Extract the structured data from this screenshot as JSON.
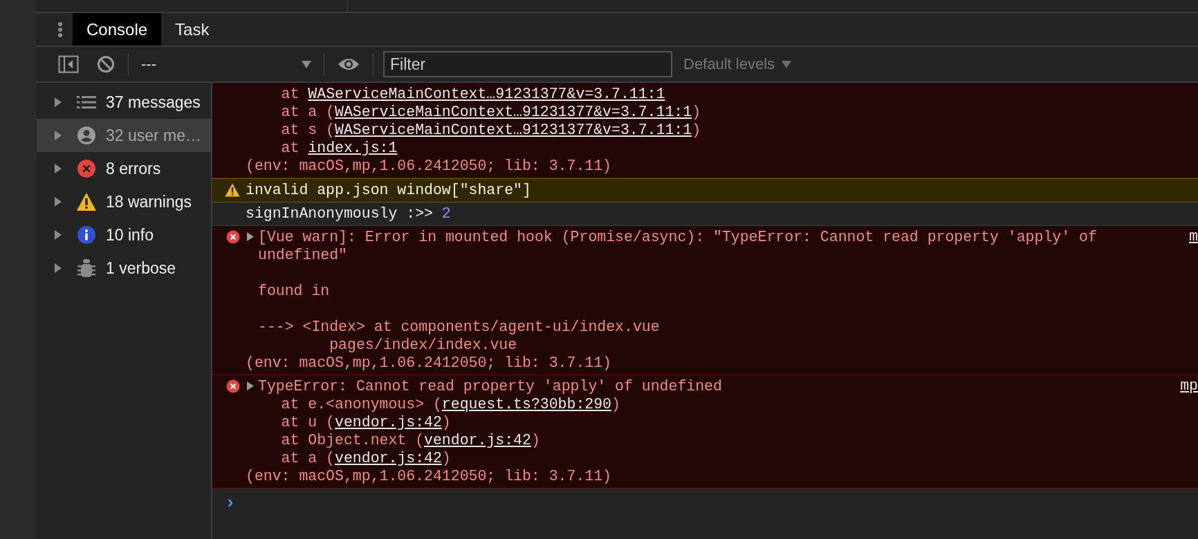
{
  "tabs": [
    {
      "label": "Console",
      "selected": true
    },
    {
      "label": "Task",
      "selected": false
    }
  ],
  "toolbar": {
    "context": "---",
    "filter": {
      "placeholder": "Filter"
    },
    "levels": "Default levels"
  },
  "sidebar": {
    "items": [
      {
        "kind": "messages",
        "label": "37 messages",
        "selected": false
      },
      {
        "kind": "user",
        "label": "32 user me…",
        "selected": true
      },
      {
        "kind": "error",
        "label": "8 errors",
        "selected": false
      },
      {
        "kind": "warning",
        "label": "18 warnings",
        "selected": false
      },
      {
        "kind": "info",
        "label": "10 info",
        "selected": false
      },
      {
        "kind": "verbose",
        "label": "1 verbose",
        "selected": false
      }
    ]
  },
  "console": {
    "messages": [
      {
        "kind": "error",
        "icon": false,
        "expandable": false,
        "lines": [
          [
            {
              "text": "    at "
            },
            {
              "text": "WAServiceMainContext…91231377&v=3.7.11:1",
              "kind": "link"
            }
          ],
          [
            {
              "text": "    at a ("
            },
            {
              "text": "WAServiceMainContext…91231377&v=3.7.11:1",
              "kind": "link"
            },
            {
              "text": ")"
            }
          ],
          [
            {
              "text": "    at s ("
            },
            {
              "text": "WAServiceMainContext…91231377&v=3.7.11:1",
              "kind": "link"
            },
            {
              "text": ")"
            }
          ],
          [
            {
              "text": "    at "
            },
            {
              "text": "index.js:1",
              "kind": "link"
            }
          ],
          [
            {
              "text": "(env: macOS,mp,1.06.2412050; lib: 3.7.11)"
            }
          ]
        ]
      },
      {
        "kind": "warning",
        "icon": true,
        "expandable": false,
        "lines": [
          [
            {
              "text": "invalid app.json window[\"share\"]"
            }
          ]
        ]
      },
      {
        "kind": "log",
        "icon": false,
        "expandable": false,
        "lines": [
          [
            {
              "text": "signInAnonymously :>> "
            },
            {
              "text": "2",
              "kind": "number"
            }
          ]
        ]
      },
      {
        "kind": "error",
        "icon": true,
        "expandable": true,
        "source": "m",
        "lines": [
          [
            {
              "text": "[Vue warn]: Error in mounted hook (Promise/async): \"TypeError: Cannot read property 'apply' of undefined\"\n\nfound in\n\n---> <Index> at components/agent-ui/index.vue\n        pages/index/index.vue"
            }
          ],
          [
            {
              "text": "(env: macOS,mp,1.06.2412050; lib: 3.7.11)"
            }
          ]
        ]
      },
      {
        "kind": "error",
        "icon": true,
        "expandable": true,
        "source": "mp",
        "lines": [
          [
            {
              "text": "TypeError: Cannot read property 'apply' of undefined"
            }
          ],
          [
            {
              "text": "    at e.<anonymous> ("
            },
            {
              "text": "request.ts?30bb:290",
              "kind": "link"
            },
            {
              "text": ")"
            }
          ],
          [
            {
              "text": "    at u ("
            },
            {
              "text": "vendor.js:42",
              "kind": "link"
            },
            {
              "text": ")"
            }
          ],
          [
            {
              "text": "    at Object.next ("
            },
            {
              "text": "vendor.js:42",
              "kind": "link"
            },
            {
              "text": ")"
            }
          ],
          [
            {
              "text": "    at a ("
            },
            {
              "text": "vendor.js:42",
              "kind": "link"
            },
            {
              "text": ")"
            }
          ],
          [
            {
              "text": "(env: macOS,mp,1.06.2412050; lib: 3.7.11)"
            }
          ]
        ]
      }
    ],
    "prompt": "›"
  }
}
